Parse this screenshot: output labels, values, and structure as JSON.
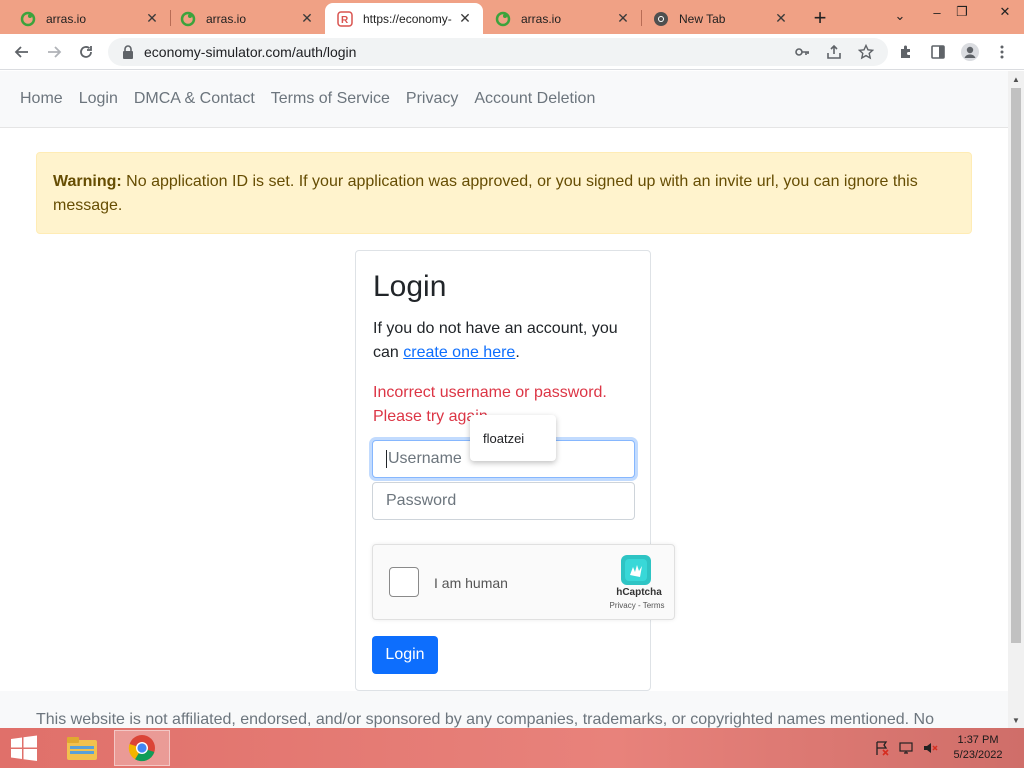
{
  "browser": {
    "tabs": [
      {
        "title": "arras.io",
        "icon": "arras-favicon"
      },
      {
        "title": "arras.io",
        "icon": "arras-favicon"
      },
      {
        "title": "https://economy-",
        "icon": "economy-favicon",
        "active": true
      },
      {
        "title": "arras.io",
        "icon": "arras-favicon"
      },
      {
        "title": "New Tab",
        "icon": "chrome-favicon"
      }
    ],
    "new_tab_label": "+",
    "url": "economy-simulator.com/auth/login",
    "toolbar_icons": [
      "back-icon",
      "forward-icon",
      "reload-icon",
      "key-icon",
      "share-icon",
      "star-icon",
      "extensions-icon",
      "sidepanel-icon",
      "profile-icon",
      "menu-icon"
    ],
    "window_controls": {
      "chevron": "⌄",
      "minimize": "–",
      "restore": "❐",
      "close": "✕"
    }
  },
  "navbar": {
    "links": [
      "Home",
      "Login",
      "DMCA & Contact",
      "Terms of Service",
      "Privacy",
      "Account Deletion"
    ]
  },
  "alert": {
    "label": "Warning:",
    "message": " No application ID is set. If your application was approved, or you signed up with an invite url, you can ignore this message."
  },
  "login": {
    "title": "Login",
    "lead_prefix": "If you do not have an account, you can ",
    "create_link": "create one here",
    "lead_suffix": ".",
    "error": "Incorrect username or password. Please try again",
    "username_placeholder": "Username",
    "password_placeholder": "Password",
    "submit_label": "Login"
  },
  "autofill": {
    "suggestion": "floatzei"
  },
  "captcha": {
    "label": "I am human",
    "brand": "hCaptcha",
    "terms": "Privacy - Terms"
  },
  "footer": {
    "text": "This website is not affiliated, endorsed, and/or sponsored by any companies, trademarks, or copyrighted names mentioned. No"
  },
  "taskbar": {
    "time": "1:37 PM",
    "date": "5/23/2022",
    "colors": {
      "accent": "#e0706a"
    }
  },
  "colors": {
    "primary": "#0d6efd",
    "danger": "#dc3545",
    "warning_bg": "#fff3cd",
    "tab_strip": "#f0a185"
  }
}
